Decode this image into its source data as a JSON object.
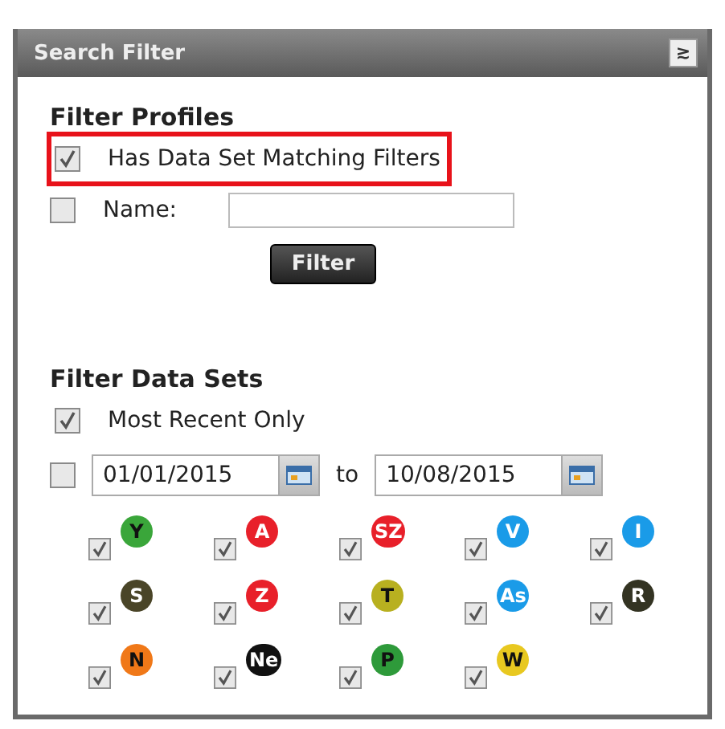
{
  "panel": {
    "title": "Search Filter",
    "collapse_icon": "≳"
  },
  "profiles": {
    "heading": "Filter Profiles",
    "has_data_set": {
      "label": "Has Data Set Matching Filters",
      "checked": true,
      "highlighted": true
    },
    "name": {
      "label": "Name:",
      "checked": false
    },
    "button": "Filter"
  },
  "data_sets": {
    "heading": "Filter Data Sets",
    "most_recent": {
      "label": "Most Recent Only",
      "checked": true
    },
    "date_range": {
      "checked": false,
      "from": "01/01/2015",
      "separator": "to",
      "to": "10/08/2015"
    },
    "sets": [
      {
        "label": "Y",
        "checked": true,
        "color": "#3aa63a",
        "dark_text": true
      },
      {
        "label": "A",
        "checked": true,
        "color": "#e8202a",
        "dark_text": false
      },
      {
        "label": "SZ",
        "checked": true,
        "color": "#e8202a",
        "dark_text": false
      },
      {
        "label": "V",
        "checked": true,
        "color": "#1a9be8",
        "dark_text": false
      },
      {
        "label": "I",
        "checked": true,
        "color": "#1a9be8",
        "dark_text": false
      },
      {
        "label": "S",
        "checked": true,
        "color": "#4a4528",
        "dark_text": false
      },
      {
        "label": "Z",
        "checked": true,
        "color": "#e8202a",
        "dark_text": false
      },
      {
        "label": "T",
        "checked": true,
        "color": "#b8b020",
        "dark_text": true
      },
      {
        "label": "As",
        "checked": true,
        "color": "#1a9be8",
        "dark_text": false
      },
      {
        "label": "R",
        "checked": true,
        "color": "#333322",
        "dark_text": false
      },
      {
        "label": "N",
        "checked": true,
        "color": "#f07818",
        "dark_text": true
      },
      {
        "label": "Ne",
        "checked": true,
        "color": "#111111",
        "dark_text": false
      },
      {
        "label": "P",
        "checked": true,
        "color": "#2e9a3a",
        "dark_text": true
      },
      {
        "label": "W",
        "checked": true,
        "color": "#e8c820",
        "dark_text": true
      }
    ]
  }
}
